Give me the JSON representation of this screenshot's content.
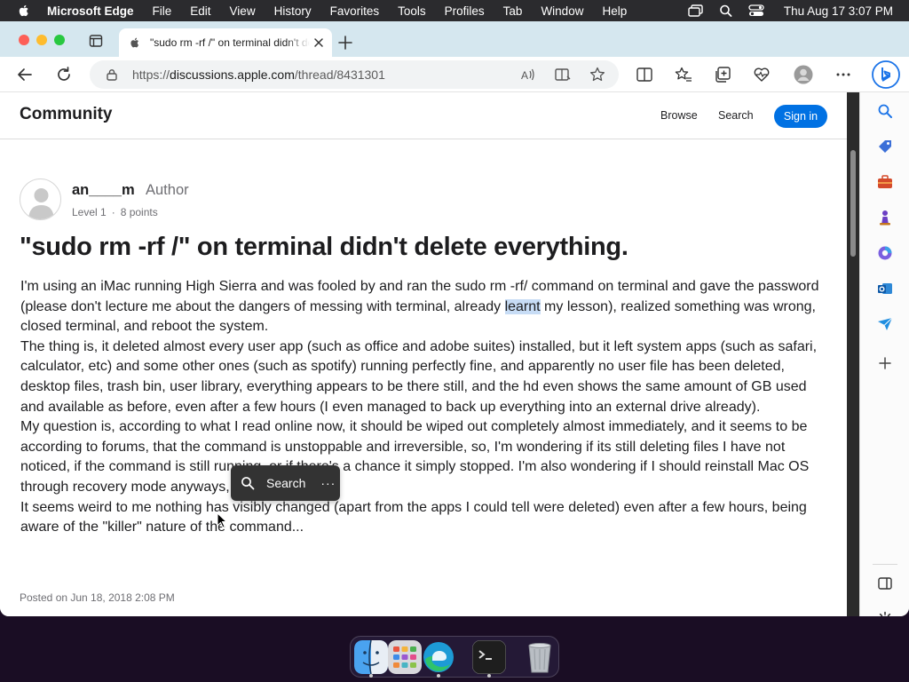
{
  "menubar": {
    "app_name": "Microsoft Edge",
    "items": [
      "File",
      "Edit",
      "View",
      "History",
      "Favorites",
      "Tools",
      "Profiles",
      "Tab",
      "Window",
      "Help"
    ],
    "clock": "Thu Aug 17  3:07 PM"
  },
  "browser": {
    "tab_title": "\"sudo rm -rf /\" on terminal didn't delete everything.",
    "url_scheme": "https://",
    "url_domain": "discussions.apple.com",
    "url_path": "/thread/8431301",
    "colors": {
      "tabstrip": "#d5e7ef",
      "accent": "#0071e3"
    }
  },
  "site": {
    "brand": "Community",
    "nav_browse": "Browse",
    "nav_search": "Search",
    "signin": "Sign in"
  },
  "post": {
    "author": "an____m",
    "author_badge": "Author",
    "level": "Level 1",
    "points": "8 points",
    "title": "\"sudo rm -rf /\" on terminal didn't delete everything.",
    "para1_before": "I'm using an iMac running High Sierra and was fooled by and ran the sudo rm -rf/ command on terminal and gave the password (please don't lecture me about the dangers of messing with terminal, already ",
    "para1_highlight": "learnt",
    "para1_after": " my lesson), realized something was wrong, closed terminal, and reboot the system.",
    "para2": "The thing is, it deleted almost every user app (such as office and adobe suites) installed, but it left system apps (such as safari, calculator, etc) and some other ones (such as spotify) running perfectly fine, and apparently no user file has been deleted, desktop files, trash bin, user library, everything appears to be there still, and the hd even shows the same amount of GB used and available as before, even after a few hours (I even managed to back up everything into an external drive already).",
    "para3": "My question is, according to what I read online now, it should be wiped out completely almost immediately, and it seems to be according to forums, that the command is unstoppable and irreversible, so, I'm wondering if its still deleting files I have not noticed, if the command is still running, or if there's a chance it simply stopped. I'm also wondering if I should reinstall Mac OS through recovery mode anyways, just to be sure?",
    "para4": "It seems weird to me nothing has visibly changed (apart from the apps I could tell were deleted) even after a few hours, being aware of the \"killer\" nature of the command...",
    "posted_on": "Posted on Jun 18, 2018 2:08 PM"
  },
  "floating_toolbar": {
    "search_label": "Search",
    "more_label": "···"
  },
  "icons": {
    "sidebar": [
      "search-icon",
      "shopping-tag-icon",
      "toolbox-icon",
      "games-icon",
      "office-icon",
      "outlook-icon",
      "drop-icon",
      "add-icon",
      "sidebar-toggle-icon",
      "settings-icon"
    ],
    "dock": [
      "finder-icon",
      "launchpad-icon",
      "edge-icon",
      "terminal-icon",
      "trash-icon"
    ]
  }
}
